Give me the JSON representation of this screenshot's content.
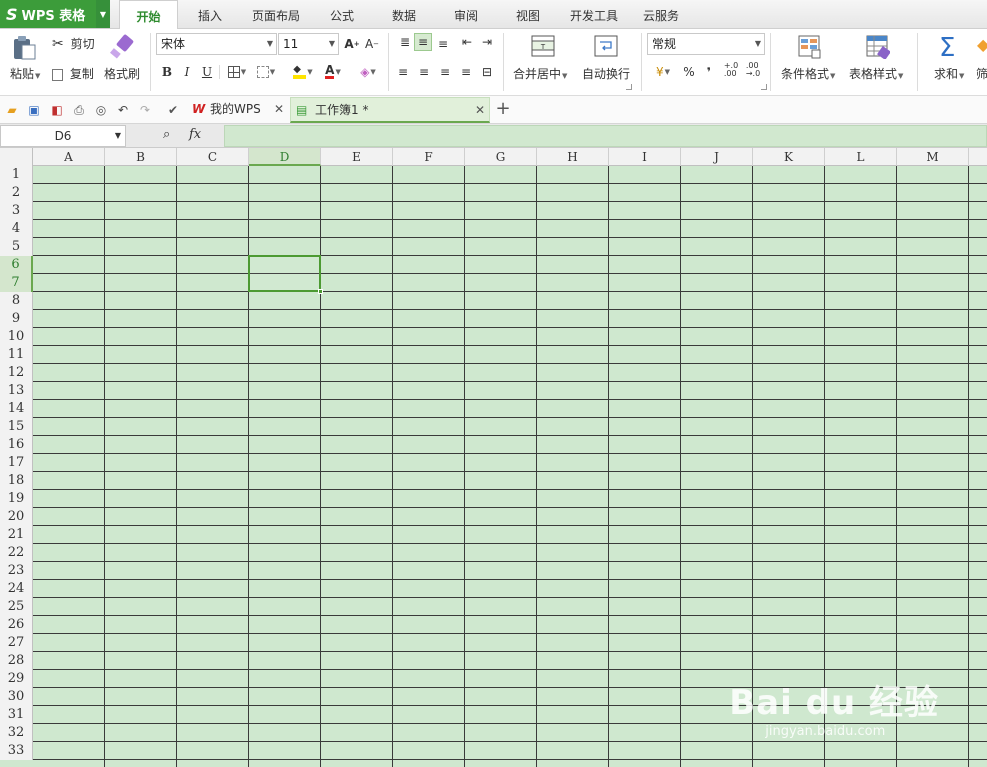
{
  "app": {
    "logo": "WPS 表格",
    "logo_mark": "S"
  },
  "menu_tabs": [
    "开始",
    "插入",
    "页面布局",
    "公式",
    "数据",
    "审阅",
    "视图",
    "开发工具",
    "云服务"
  ],
  "ribbon": {
    "paste": "粘贴",
    "cut": "剪切",
    "copy": "复制",
    "format_painter": "格式刷",
    "font_name": "宋体",
    "font_size": "11",
    "bold": "B",
    "italic": "I",
    "underline": "U",
    "merge_center": "合并居中",
    "wrap_text": "自动换行",
    "number_format": "常规",
    "percent": "%",
    "comma": "❜",
    "inc_decimal": "+.0\n.00",
    "dec_decimal": ".00\n→.0",
    "conditional_format": "条件格式",
    "table_style": "表格样式",
    "sum": "求和",
    "filter_partial": "筛"
  },
  "quick_access": {
    "tabs": [
      {
        "label": "我的WPS"
      },
      {
        "label": "工作簿1 *"
      }
    ],
    "add_tab": "+"
  },
  "formula_bar": {
    "name_box": "D6",
    "fx": "fx"
  },
  "sheet": {
    "columns": [
      "A",
      "B",
      "C",
      "D",
      "E",
      "F",
      "G",
      "H",
      "I",
      "J",
      "K",
      "L",
      "M"
    ],
    "rows": [
      "1",
      "2",
      "3",
      "4",
      "5",
      "6",
      "7",
      "8",
      "9",
      "10",
      "11",
      "12",
      "13",
      "14",
      "15",
      "16",
      "17",
      "18",
      "19",
      "20",
      "21",
      "22",
      "23",
      "24",
      "25",
      "26",
      "27",
      "28",
      "29",
      "30",
      "31",
      "32",
      "33"
    ],
    "selected_cell": "D6",
    "selected_column": "D",
    "selected_rows": [
      "6",
      "7"
    ],
    "background_color": "#cfe8cf",
    "grid_color": "#3a3a3a"
  },
  "watermark": {
    "main": "Bai du 经验",
    "sub": "jingyan.baidu.com"
  }
}
